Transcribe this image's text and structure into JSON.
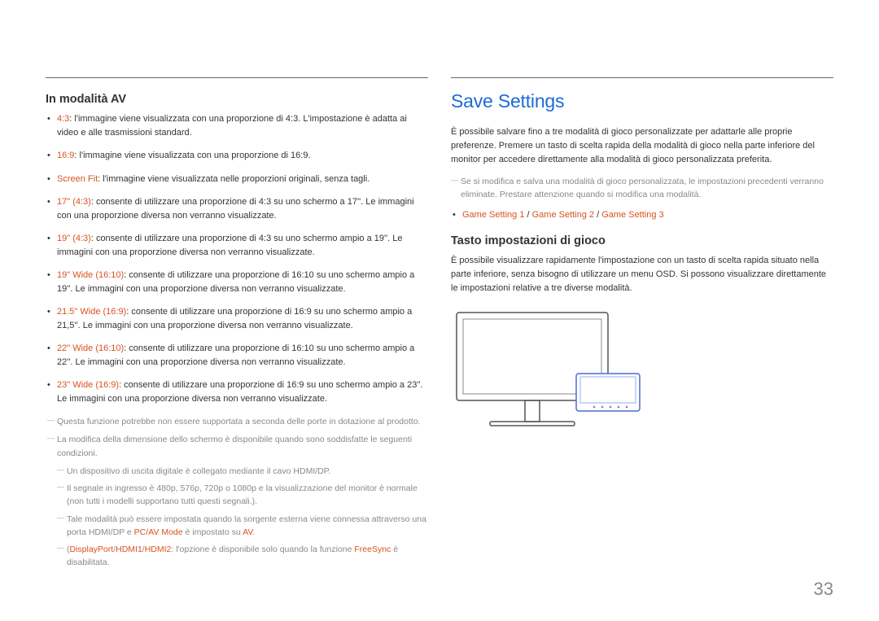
{
  "left": {
    "heading": "In modalità AV",
    "items": [
      {
        "label": "4:3",
        "text": ": l'immagine viene visualizzata con una proporzione di 4:3. L'impostazione è adatta ai video e alle trasmissioni standard."
      },
      {
        "label": "16:9",
        "text": ": l'immagine viene visualizzata con una proporzione di 16:9."
      },
      {
        "label": "Screen Fit",
        "text": ": l'immagine viene visualizzata nelle proporzioni originali, senza tagli."
      },
      {
        "label": "17\" (4:3)",
        "text": ": consente di utilizzare una proporzione di 4:3 su uno schermo a 17''. Le immagini con una proporzione diversa non verranno visualizzate."
      },
      {
        "label": "19\" (4:3)",
        "text": ": consente di utilizzare una proporzione di 4:3 su uno schermo ampio a 19''. Le immagini con una proporzione diversa non verranno visualizzate."
      },
      {
        "label": "19\" Wide (16:10)",
        "text": ": consente di utilizzare una proporzione di 16:10 su uno schermo ampio a 19''. Le immagini con una proporzione diversa non verranno visualizzate."
      },
      {
        "label": "21.5\" Wide (16:9)",
        "text": ": consente di utilizzare una proporzione di 16:9 su uno schermo ampio a 21,5''. Le immagini con una proporzione diversa non verranno visualizzate."
      },
      {
        "label": "22\" Wide (16:10)",
        "text": ": consente di utilizzare una proporzione di 16:10 su uno schermo ampio a 22''. Le immagini con una proporzione diversa non verranno visualizzate."
      },
      {
        "label": "23\" Wide (16:9)",
        "text": ": consente di utilizzare una proporzione di 16:9 su uno schermo ampio a 23''. Le immagini con una proporzione diversa non verranno visualizzate."
      }
    ],
    "note1": "Questa funzione potrebbe non essere supportata a seconda delle porte in dotazione al prodotto.",
    "note2": "La modifica della dimensione dello schermo è disponibile quando sono soddisfatte le seguenti condizioni.",
    "sub1": "Un dispositivo di uscita digitale è collegato mediante il cavo HDMI/DP.",
    "sub2": "Il segnale in ingresso è 480p, 576p, 720p o 1080p e la visualizzazione del monitor è normale (non tutti i modelli supportano tutti questi segnali.).",
    "sub3_pre": "Tale modalità può essere impostata quando la sorgente esterna viene connessa attraverso una porta HDMI/DP e ",
    "sub3_hl1": "PC/AV Mode",
    "sub3_mid": " è impostato su ",
    "sub3_hl2": "AV",
    "sub3_post": ".",
    "sub4_pre": "(",
    "sub4_hl1": "DisplayPort",
    "sub4_s1": "/",
    "sub4_hl2": "HDMI1",
    "sub4_s2": "/",
    "sub4_hl3": "HDMI2",
    "sub4_mid": ": l'opzione è disponibile solo quando la funzione ",
    "sub4_hl4": "FreeSync",
    "sub4_post": " è disabilitata."
  },
  "right": {
    "title": "Save Settings",
    "para1": "È possibile salvare fino a tre modalità di gioco personalizzate per adattarle alle proprie preferenze. Premere un tasto di scelta rapida della modalità di gioco nella parte inferiore del monitor per accedere direttamente alla modalità di gioco personalizzata preferita.",
    "note1": "Se si modifica e salva una modalità di gioco personalizzata, le impostazioni precedenti verranno eliminate. Prestare attenzione quando si modifica una modalità.",
    "settings_line_a": "Game Setting 1",
    "settings_sep1": " / ",
    "settings_line_b": "Game Setting 2",
    "settings_sep2": " / ",
    "settings_line_c": "Game Setting 3",
    "sub_heading": "Tasto impostazioni di gioco",
    "para2": "È possibile visualizzare rapidamente l'impostazione con un tasto di scelta rapida situato nella parte inferiore, senza bisogno di utilizzare un menu OSD. Si possono visualizzare direttamente le impostazioni relative a tre diverse modalità."
  },
  "page_number": "33"
}
